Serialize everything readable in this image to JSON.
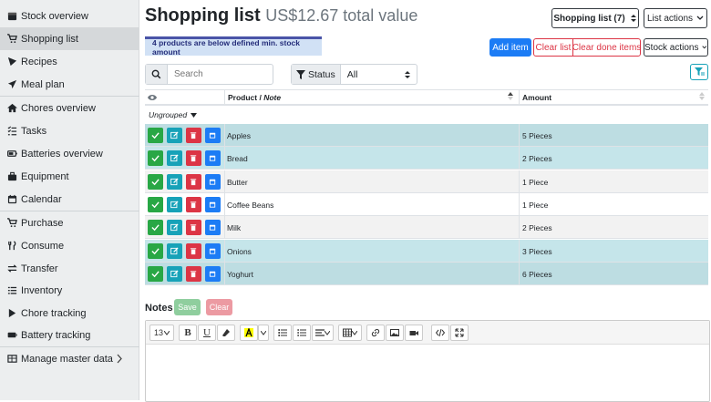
{
  "sidebar": {
    "items": [
      {
        "label": "Stock overview",
        "icon": "box-icon"
      },
      {
        "label": "Shopping list",
        "icon": "shopping-cart-icon",
        "active": true
      },
      {
        "label": "Recipes",
        "icon": "pizza-icon"
      },
      {
        "label": "Meal plan",
        "icon": "paper-plane-icon"
      },
      {
        "label": "Chores overview",
        "icon": "home-icon"
      },
      {
        "label": "Tasks",
        "icon": "tasks-icon"
      },
      {
        "label": "Batteries overview",
        "icon": "battery-icon"
      },
      {
        "label": "Equipment",
        "icon": "toolbox-icon"
      },
      {
        "label": "Calendar",
        "icon": "calendar-icon"
      },
      {
        "label": "Purchase",
        "icon": "cart-plus-icon"
      },
      {
        "label": "Consume",
        "icon": "utensils-icon"
      },
      {
        "label": "Transfer",
        "icon": "exchange-icon"
      },
      {
        "label": "Inventory",
        "icon": "list-icon"
      },
      {
        "label": "Chore tracking",
        "icon": "play-icon"
      },
      {
        "label": "Battery tracking",
        "icon": "battery-tracking-icon"
      },
      {
        "label": "Manage master data",
        "icon": "table-icon"
      }
    ]
  },
  "header": {
    "title": "Shopping list",
    "total_value": "US$12.67 total value",
    "list_selector": "Shopping list (7)",
    "list_actions": "List actions",
    "stock_actions": "Stock actions"
  },
  "alert": "4 products are below defined min. stock amount",
  "buttons": {
    "add_item": "Add item",
    "clear_list": "Clear list",
    "clear_done": "Clear done items"
  },
  "search": {
    "placeholder": "Search",
    "value": ""
  },
  "status_filter": {
    "label": "Status",
    "value": "All"
  },
  "table": {
    "col_product": "Product / ",
    "col_note": "Note",
    "col_amount": "Amount",
    "group": "Ungrouped",
    "rows": [
      {
        "name": "Apples",
        "amount": "5 Pieces",
        "below_min": true
      },
      {
        "name": "Bread",
        "amount": "2 Pieces",
        "below_min": true
      },
      {
        "name": "Butter",
        "amount": "1 Piece",
        "below_min": false
      },
      {
        "name": "Coffee Beans",
        "amount": "1 Piece",
        "below_min": false
      },
      {
        "name": "Milk",
        "amount": "2 Pieces",
        "below_min": false
      },
      {
        "name": "Onions",
        "amount": "3 Pieces",
        "below_min": true
      },
      {
        "name": "Yoghurt",
        "amount": "6 Pieces",
        "below_min": true
      }
    ]
  },
  "notes": {
    "title": "Notes",
    "save": "Save",
    "clear": "Clear",
    "font_size": "13"
  },
  "colors": {
    "primary": "#1c7cf5",
    "success": "#28a745",
    "info": "#17a2b8",
    "danger": "#dc3545",
    "row_highlight": "#bfe0e6"
  }
}
